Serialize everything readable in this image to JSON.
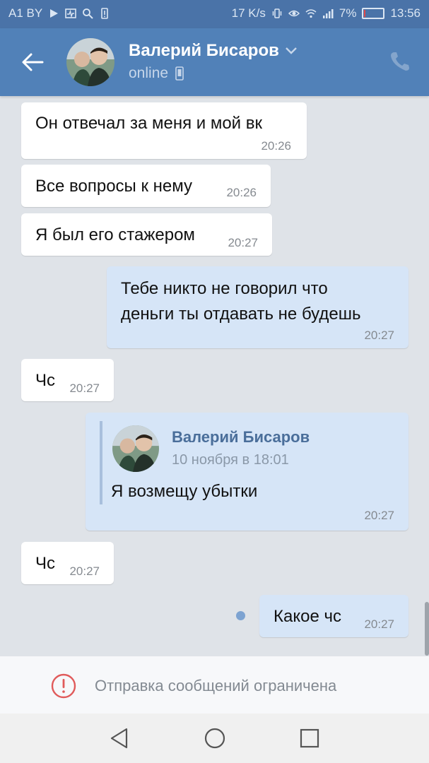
{
  "status_bar": {
    "carrier": "A1 BY",
    "speed": "17 K/s",
    "battery": "7%",
    "battery_level": 0.07,
    "time": "13:56"
  },
  "header": {
    "name": "Валерий Бисаров",
    "status": "online"
  },
  "messages": [
    {
      "direction": "in",
      "text": "Он отвечал за меня и мой вк",
      "time": "20:26"
    },
    {
      "direction": "in",
      "text": "Все вопросы к нему",
      "time": "20:26"
    },
    {
      "direction": "in",
      "text": "Я был его стажером",
      "time": "20:27"
    },
    {
      "direction": "out",
      "lines": [
        "Тебе никто не говорил что",
        "деньги ты отдавать не будешь"
      ],
      "time": "20:27"
    },
    {
      "direction": "in",
      "text": "Чс",
      "time": "20:27"
    },
    {
      "direction": "out",
      "forwarded": {
        "name": "Валерий Бисаров",
        "date": "10 ноября в 18:01",
        "text": "Я возмещу убытки"
      },
      "time": "20:27"
    },
    {
      "direction": "in",
      "text": "Чс",
      "time": "20:27"
    },
    {
      "direction": "out",
      "text": "Какое чс",
      "time": "20:27",
      "unread": true
    }
  ],
  "restriction": {
    "text": "Отправка сообщений ограничена",
    "icon": "warning-circle-icon",
    "color": "#e05a5a"
  },
  "colors": {
    "header": "#5181b8",
    "status_bar": "#4a73a8",
    "outgoing_bubble": "#d6e5f7",
    "incoming_bubble": "#ffffff",
    "background": "#dfe3e8"
  }
}
